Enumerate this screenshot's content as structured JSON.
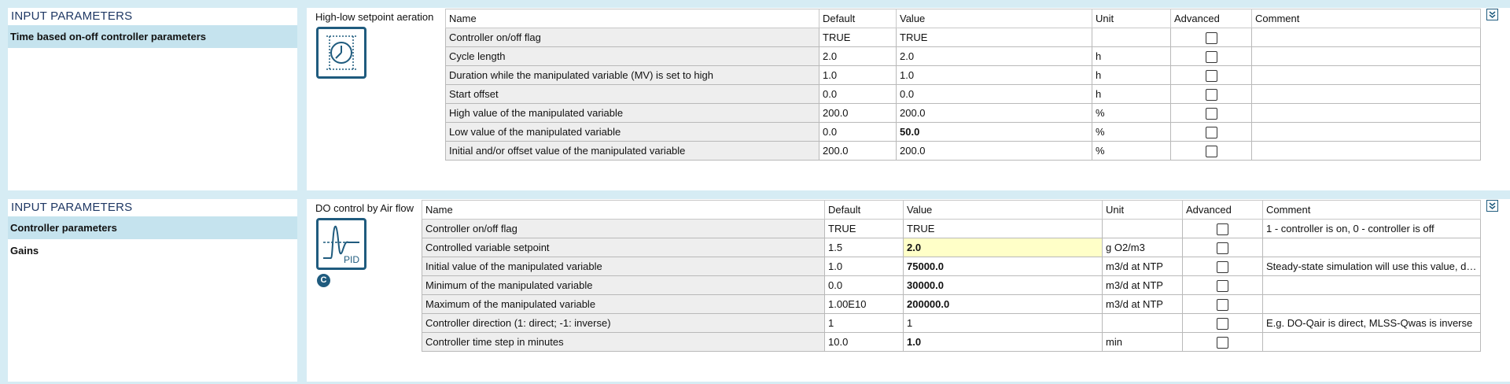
{
  "panels": [
    {
      "left_header": "INPUT PARAMETERS",
      "left_items": [
        {
          "label": "Time based on-off controller parameters",
          "selected": true
        }
      ],
      "model_title": "High-low setpoint aeration",
      "icon": "clock-icon",
      "columns": [
        "Name",
        "Default",
        "Value",
        "Unit",
        "Advanced",
        "Comment"
      ],
      "rows": [
        {
          "name": "Controller on/off flag",
          "default": "TRUE",
          "value": "TRUE",
          "unit": "",
          "advanced": false,
          "comment": "",
          "bold": false
        },
        {
          "name": "Cycle length",
          "default": "2.0",
          "value": "2.0",
          "unit": "h",
          "advanced": false,
          "comment": "",
          "bold": false
        },
        {
          "name": "Duration while the manipulated variable (MV) is set to high",
          "default": "1.0",
          "value": "1.0",
          "unit": "h",
          "advanced": false,
          "comment": "",
          "bold": false
        },
        {
          "name": "Start offset",
          "default": "0.0",
          "value": "0.0",
          "unit": "h",
          "advanced": false,
          "comment": "",
          "bold": false
        },
        {
          "name": "High value of the manipulated variable",
          "default": "200.0",
          "value": "200.0",
          "unit": "%",
          "advanced": false,
          "comment": "",
          "bold": false
        },
        {
          "name": "Low value of the manipulated variable",
          "default": "0.0",
          "value": "50.0",
          "unit": "%",
          "advanced": false,
          "comment": "",
          "bold": true
        },
        {
          "name": "Initial and/or offset value of the manipulated variable",
          "default": "200.0",
          "value": "200.0",
          "unit": "%",
          "advanced": false,
          "comment": "",
          "bold": false
        }
      ]
    },
    {
      "left_header": "INPUT PARAMETERS",
      "left_items": [
        {
          "label": "Controller parameters",
          "selected": true
        },
        {
          "label": "Gains",
          "selected": false
        }
      ],
      "model_title": "DO control by Air flow",
      "icon": "pid-icon",
      "icon_label": "PID",
      "badge": "C",
      "columns": [
        "Name",
        "Default",
        "Value",
        "Unit",
        "Advanced",
        "Comment"
      ],
      "rows": [
        {
          "name": "Controller on/off flag",
          "default": "TRUE",
          "value": "TRUE",
          "unit": "",
          "advanced": false,
          "comment": "1 - controller is on, 0 - controller is off",
          "bold": false
        },
        {
          "name": "Controlled variable setpoint",
          "default": "1.5",
          "value": "2.0",
          "unit": "g O2/m3",
          "advanced": false,
          "comment": "",
          "bold": true,
          "highlight": true
        },
        {
          "name": "Initial value of the manipulated variable",
          "default": "1.0",
          "value": "75000.0",
          "unit": "m3/d at NTP",
          "advanced": false,
          "comment": "Steady-state simulation will use this value, dynamic simulation will use this value as initial value",
          "bold": true
        },
        {
          "name": "Minimum of the manipulated variable",
          "default": "0.0",
          "value": "30000.0",
          "unit": "m3/d at NTP",
          "advanced": false,
          "comment": "",
          "bold": true
        },
        {
          "name": "Maximum of the manipulated variable",
          "default": "1.00E10",
          "value": "200000.0",
          "unit": "m3/d at NTP",
          "advanced": false,
          "comment": "",
          "bold": true
        },
        {
          "name": "Controller direction (1: direct; -1: inverse)",
          "default": "1",
          "value": "1",
          "unit": "",
          "advanced": false,
          "comment": "E.g. DO-Qair is direct, MLSS-Qwas is inverse",
          "bold": false
        },
        {
          "name": "Controller time step in minutes",
          "default": "10.0",
          "value": "1.0",
          "unit": "min",
          "advanced": false,
          "comment": "",
          "bold": true
        }
      ]
    }
  ]
}
